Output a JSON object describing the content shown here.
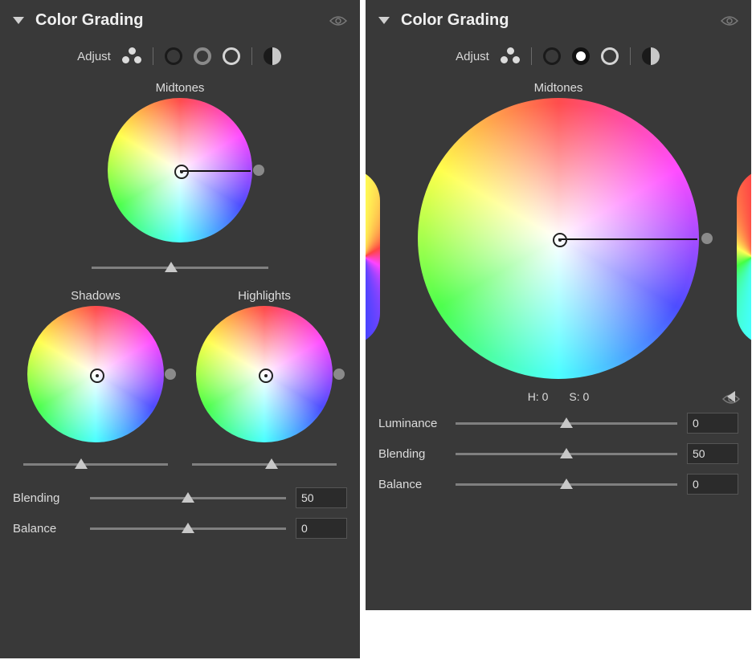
{
  "left": {
    "title": "Color Grading",
    "adjust_label": "Adjust",
    "midtones_label": "Midtones",
    "shadows_label": "Shadows",
    "highlights_label": "Highlights",
    "blending": {
      "label": "Blending",
      "value": "50",
      "pct": 50
    },
    "balance": {
      "label": "Balance",
      "value": "0",
      "pct": 50
    },
    "midtones_slider_pct": 45,
    "shadows_slider_pct": 40,
    "highlights_slider_pct": 55
  },
  "right": {
    "title": "Color Grading",
    "adjust_label": "Adjust",
    "midtones_label": "Midtones",
    "hue": {
      "label": "H:",
      "value": "0"
    },
    "saturation": {
      "label": "S:",
      "value": "0"
    },
    "luminance": {
      "label": "Luminance",
      "value": "0",
      "pct": 50
    },
    "blending": {
      "label": "Blending",
      "value": "50",
      "pct": 50
    },
    "balance": {
      "label": "Balance",
      "value": "0",
      "pct": 50
    }
  }
}
